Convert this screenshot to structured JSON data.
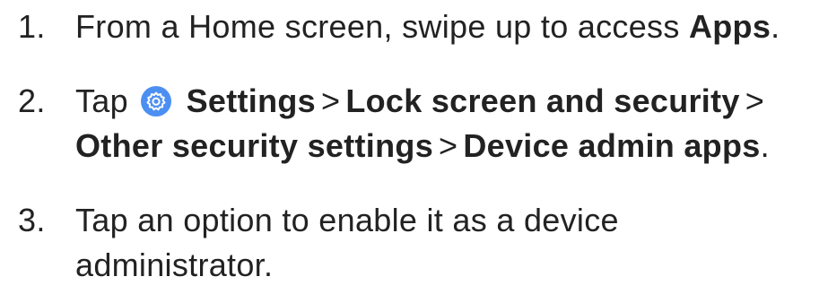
{
  "steps": [
    {
      "number": "1.",
      "text_before": "From a Home screen, swipe up to access ",
      "bold": "Apps",
      "text_after": "."
    },
    {
      "number": "2.",
      "tap": "Tap",
      "icon": "settings-gear-icon",
      "icon_color": "#4c8ff2",
      "path": [
        "Settings",
        "Lock screen and security",
        "Other security settings",
        "Device admin apps"
      ],
      "separator": ">",
      "end": "."
    },
    {
      "number": "3.",
      "line1": "Tap an option to enable it as a device",
      "line2": "administrator."
    }
  ]
}
